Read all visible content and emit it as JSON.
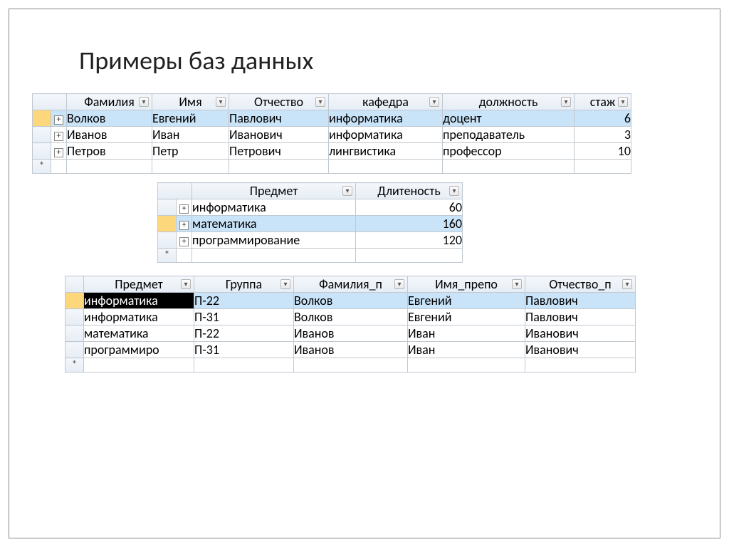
{
  "title": "Примеры баз данных",
  "table1": {
    "headers": [
      "Фамилия",
      "Имя",
      "Отчество",
      "кафедра",
      "должность",
      "стаж"
    ],
    "rows": [
      {
        "selected": true,
        "cells": [
          "Волков",
          "Евгений",
          "Павлович",
          "информатика",
          "доцент",
          "6"
        ]
      },
      {
        "selected": false,
        "cells": [
          "Иванов",
          "Иван",
          "Иванович",
          "информатика",
          "преподаватель",
          "3"
        ]
      },
      {
        "selected": false,
        "cells": [
          "Петров",
          "Петр",
          "Петрович",
          "лингвистика",
          "профессор",
          "10"
        ]
      }
    ],
    "new_row_marker": "*"
  },
  "table2": {
    "headers": [
      "Предмет",
      "Длитеность"
    ],
    "rows": [
      {
        "selected": false,
        "cells": [
          "информатика",
          "60"
        ]
      },
      {
        "selected": true,
        "cells": [
          "математика",
          "160"
        ]
      },
      {
        "selected": false,
        "cells": [
          "программирование",
          "120"
        ]
      }
    ],
    "new_row_marker": "*"
  },
  "table3": {
    "headers": [
      "Предмет",
      "Группа",
      "Фамилия_п",
      "Имя_препо",
      "Отчество_п"
    ],
    "rows": [
      {
        "selected": true,
        "cell0_selected": true,
        "cells": [
          "информатика",
          "П-22",
          "Волков",
          "Евгений",
          "Павлович"
        ]
      },
      {
        "selected": false,
        "cell0_selected": false,
        "cells": [
          "информатика",
          "П-31",
          "Волков",
          "Евгений",
          "Павлович"
        ]
      },
      {
        "selected": false,
        "cell0_selected": false,
        "cells": [
          "математика",
          "П-22",
          "Иванов",
          "Иван",
          "Иванович"
        ]
      },
      {
        "selected": false,
        "cell0_selected": false,
        "cells": [
          "программиро",
          "П-31",
          "Иванов",
          "Иван",
          "Иванович"
        ]
      }
    ],
    "new_row_marker": "*"
  },
  "col_widths": {
    "t1": [
      120,
      108,
      140,
      160,
      185,
      80
    ],
    "t2": [
      230,
      150
    ],
    "t3": [
      155,
      140,
      160,
      165,
      155
    ]
  }
}
